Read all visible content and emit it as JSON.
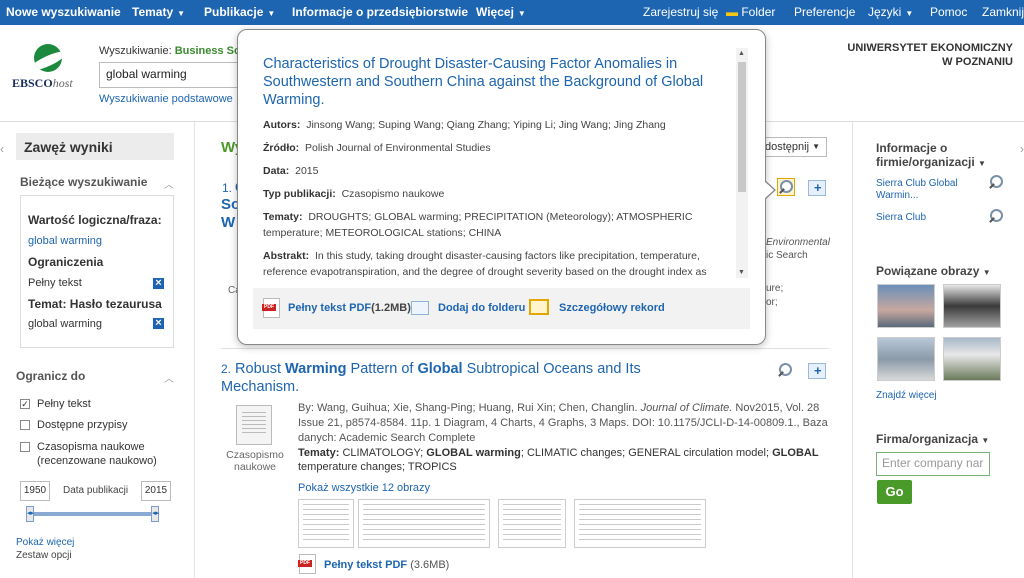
{
  "topnav": {
    "left": [
      "Nowe wyszukiwanie",
      "Tematy",
      "Publikacje",
      "Informacje o przedsiębiorstwie",
      "Więcej"
    ],
    "right": [
      "Zarejestruj się",
      "Folder",
      "Preferencje",
      "Języki",
      "Pomoc",
      "Zamknij"
    ]
  },
  "logo": {
    "brand": "EBSCO",
    "host": "host"
  },
  "search": {
    "label_prefix": "Wyszukiwanie:",
    "database_fragment": "Business Sou",
    "query": "global warming",
    "basic_link": "Wyszukiwanie podstawowe"
  },
  "institution": [
    "UNIWERSYTET EKONOMICZNY",
    "W POZNANIU"
  ],
  "left_panel": {
    "narrow_title": "Zawęż wyniki",
    "current_search_title": "Bieżące wyszukiwanie",
    "boolean_label": "Wartość logiczna/fraza:",
    "boolean_value": "global warming",
    "limits_label": "Ograniczenia",
    "limit_value": "Pełny tekst",
    "subject_label": "Temat: Hasło tezaurusa",
    "subject_value": "global warming",
    "limit_to_title": "Ogranicz do",
    "checkboxes": [
      {
        "label": "Pełny tekst",
        "checked": true
      },
      {
        "label": "Dostępne przypisy",
        "checked": false
      },
      {
        "label": "Czasopisma naukowe (recenzowane naukowo)",
        "checked": false
      }
    ],
    "year_from": "1950",
    "year_label": "Data publikacji",
    "year_to": "2015",
    "show_more": "Pokaż więcej",
    "options": "Zestaw opcji"
  },
  "main": {
    "results_heading_fragment": "Wy",
    "sort_fragment": "dostępnij",
    "result1": {
      "number": "1.",
      "title_fragments": [
        "C",
        "So",
        "W"
      ],
      "source_fragment": "Environmental",
      "db_fragment": "ic Search",
      "ure_fragment": "ure;",
      "or_fragment": "or;",
      "ca_fragment": "Ca"
    },
    "result2": {
      "number": "2.",
      "title_pre": "Robust ",
      "title_b1": "Warming",
      "title_mid": " Pattern of ",
      "title_b2": "Global",
      "title_post": " Subtropical Oceans and Its Mechanism.",
      "doc_type": "Czasopismo naukowe",
      "meta_by": "By: Wang, Guihua; Xie, Shang-Ping; Huang, Rui Xin; Chen, Changlin.",
      "meta_journal": "Journal of Climate.",
      "meta_rest": "Nov2015, Vol. 28 Issue 21, p8574-8584. 11p. 1 Diagram, 4 Charts, 4 Graphs, 3 Maps. DOI: 10.1175/JCLI-D-14-00809.1., Baza danych: Academic Search Complete",
      "subjects_label": "Tematy:",
      "subjects_a": "CLIMATOLOGY;",
      "subjects_b1": "GLOBAL warming",
      "subjects_c": "; CLIMATIC changes; GENERAL circulation model;",
      "subjects_b2": "GLOBAL",
      "subjects_d": "temperature changes; TROPICS",
      "show_images": "Pokaż wszystkie 12 obrazy",
      "pdf_label": "Pełny tekst PDF",
      "pdf_size": "(3.6MB)"
    }
  },
  "popup": {
    "title": "Characteristics of Drought Disaster-Causing Factor Anomalies in Southwestern and Southern China against the Background of Global Warming.",
    "authors_label": "Autors:",
    "authors": "Jinsong Wang; Suping Wang; Qiang Zhang; Yiping Li; Jing Wang; Jing Zhang",
    "source_label": "Źródło:",
    "source": "Polish Journal of Environmental Studies",
    "date_label": "Data:",
    "date": "2015",
    "pubtype_label": "Typ publikacji:",
    "pubtype": "Czasopismo naukowe",
    "subjects_label": "Tematy:",
    "subjects": "DROUGHTS; GLOBAL warming; PRECIPITATION (Meteorology); ATMOSPHERIC temperature; METEOROLOGICAL stations; CHINA",
    "abstract_label": "Abstrakt:",
    "abstract": "In this study, taking drought disaster-causing factors like precipitation, temperature, reference evapotranspiration, and the degree of drought severity based on the drought index as",
    "pdf_label": "Pełny tekst PDF",
    "pdf_size": "(1.2MB)",
    "add_folder": "Dodaj do folderu",
    "detailed": "Szczegółowy rekord"
  },
  "right_panel": {
    "company_info_title": "Informacje o firmie/organizacji",
    "company_links": [
      "Sierra Club Global Warmin...",
      "Sierra Club"
    ],
    "related_images_title": "Powiązane obrazy",
    "find_more": "Znajdź więcej",
    "firm_title": "Firma/organizacja",
    "company_placeholder": "Enter company nar",
    "go": "Go"
  }
}
